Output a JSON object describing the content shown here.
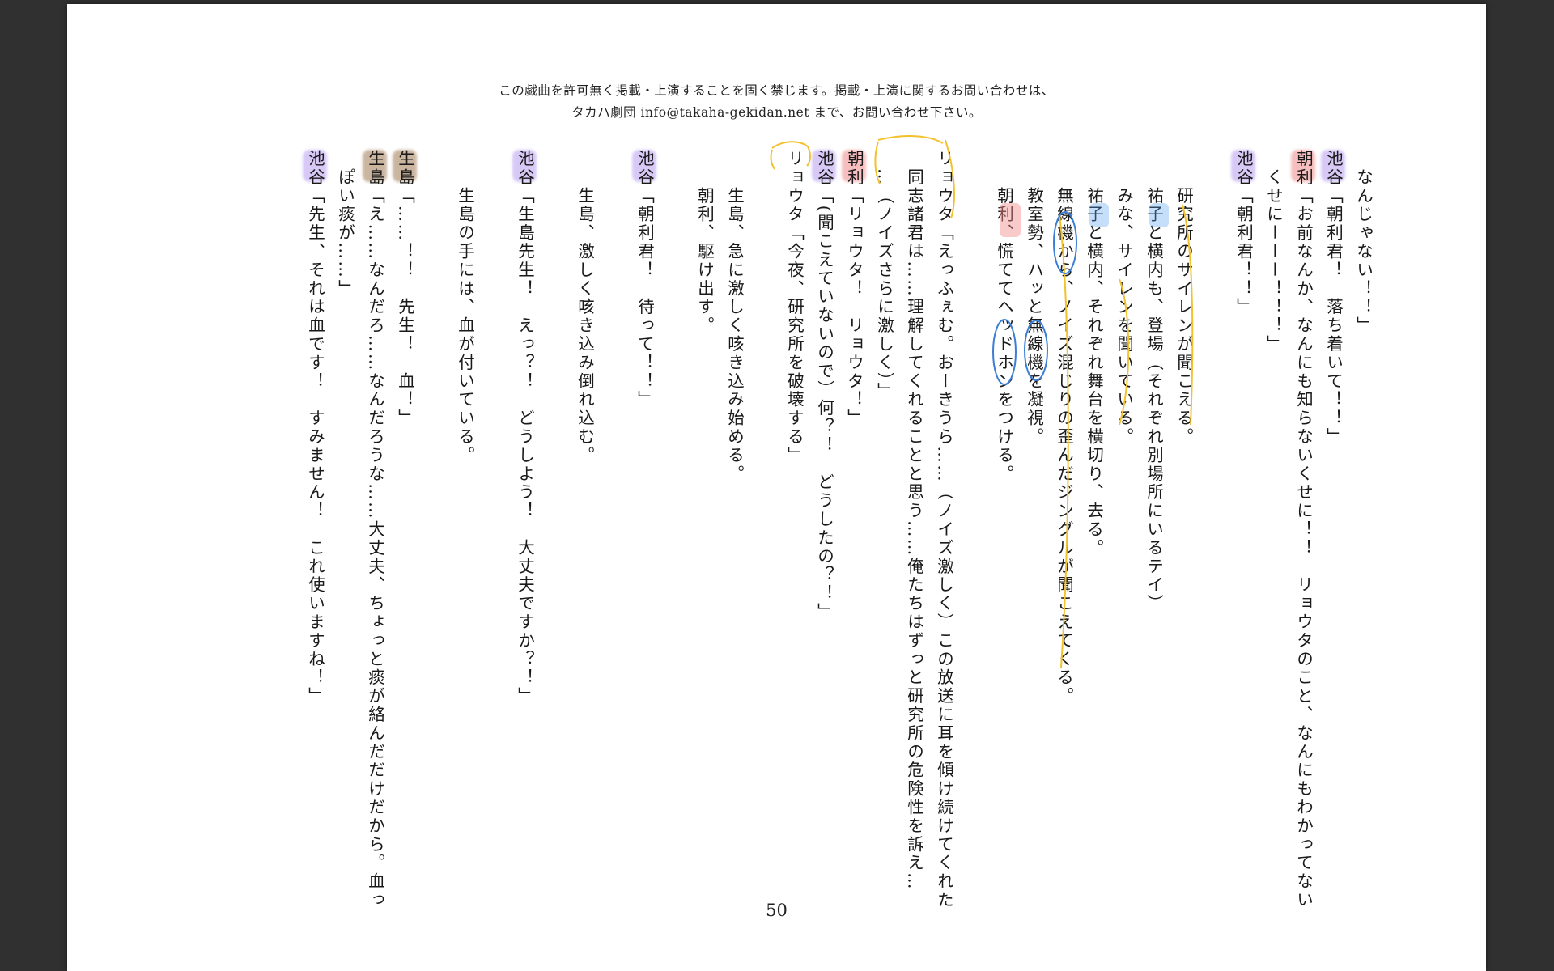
{
  "document": {
    "notice_line1": "この戯曲を許可無く掲載・上演することを固く禁じます。掲載・上演に関するお問い合わせは、",
    "notice_line2": "タカハ劇団 info@takaha-gekidan.net まで、お問い合わせ下さい。",
    "page_number": "50",
    "lines": [
      "　なんじゃない！！」",
      "池谷「朝利君！　落ち着いて！！」",
      "朝利「お前なんか、なんにも知らないくせに！！　リョウタのこと、なんにもわかってない",
      "　くせにーーー！！！」",
      "池谷「朝利君！！」",
      "",
      "　　研究所のサイレンが聞こえる。",
      "　　祐子と横内も、登場（それぞれ別場所にいるテイ）",
      "　　みな、サイレンを聞いている。",
      "　　祐子と横内、それぞれ舞台を横切り、去る。",
      "　　無線機から、ノイズ混じりの歪んだジングルが聞こえてくる。",
      "　　教室勢、ハッと無線機を凝視。",
      "　　朝利、慌ててヘッドホンをつける。",
      "",
      "リョウタ「えっふぇむ。おーきうら……（ノイズ激しく）この放送に耳を傾け続けてくれた",
      "　同志諸君は……理解してくれることと思う……俺たちはずっと研究所の危険性を訴え…",
      "　…（ノイズさらに激しく）」",
      "朝利「リョウタ！　リョウタ！」",
      "池谷「(聞こえていないので）何？！　どうしたの？！」",
      "リョウタ「今夜、研究所を破壊する」",
      "",
      "　　生島、急に激しく咳き込み始める。",
      "　　朝利、駆け出す。",
      "",
      "池谷「朝利君！　待って！！」",
      "",
      "　　生島、激しく咳き込み倒れ込む。",
      "",
      "池谷「生島先生！　えっ？！　どうしよう！　大丈夫ですか？！」",
      "",
      "　　生島の手には、血が付いている。",
      "",
      "生島「……！！　先生！　血！」",
      "生島「え……なんだろ……なんだろうな……大丈夫、ちょっと痰が絡んだだけだから。血っ",
      "　ぽい痰が……」",
      "池谷「先生、それは血です！　すみません！　これ使いますね！」"
    ]
  },
  "highlights": {
    "池谷": "#b79cf0",
    "朝利": "#f08a8a",
    "生島": "#a07a52",
    "祐子": "#5aa0ee",
    "ink_yellow": "#f2c12e",
    "ink_blue": "#3a7fd6"
  }
}
